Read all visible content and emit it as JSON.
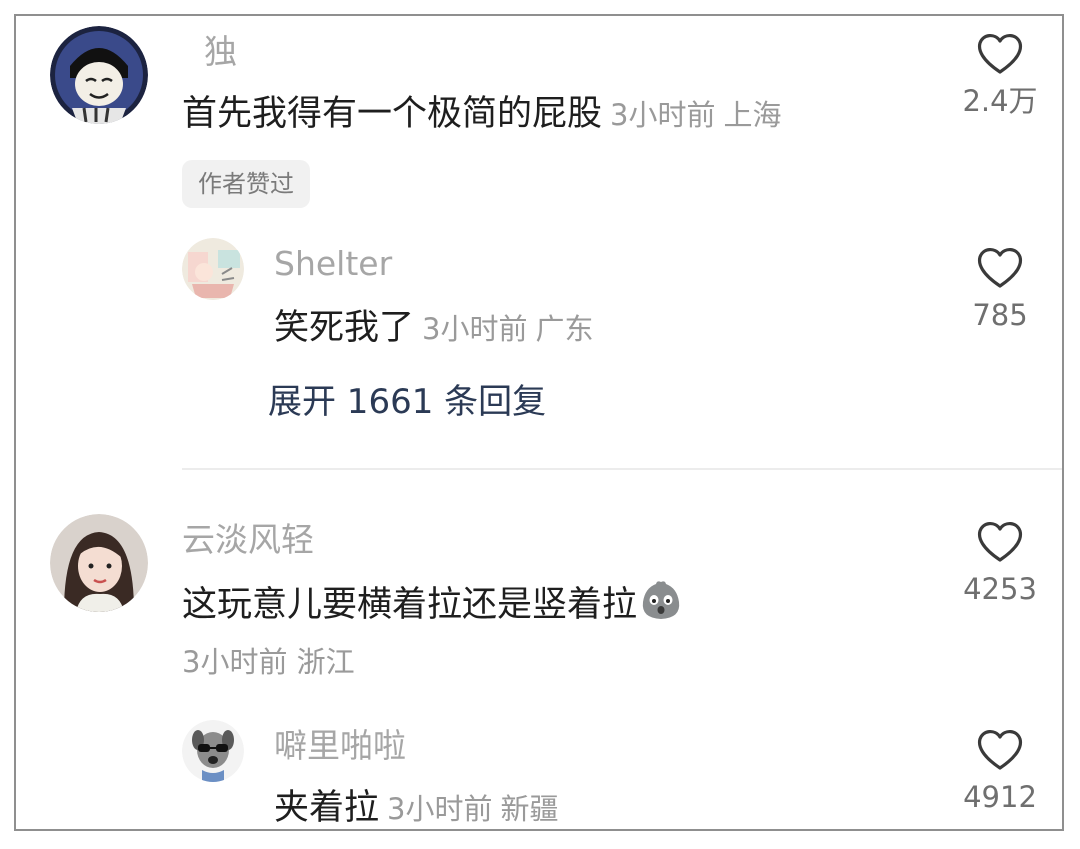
{
  "comments": [
    {
      "username": "独",
      "text": "首先我得有一个极简的屁股",
      "time": "3小时前",
      "location": "上海",
      "likes": "2.4万",
      "badge": "作者赞过",
      "replies": [
        {
          "username": "Shelter",
          "text": "笑死我了",
          "time": "3小时前",
          "location": "广东",
          "likes": "785"
        }
      ],
      "expand_label": "展开 1661 条回复"
    },
    {
      "username": "云淡风轻",
      "text": "这玩意儿要横着拉还是竖着拉",
      "time": "3小时前",
      "location": "浙江",
      "likes": "4253",
      "replies": [
        {
          "username": "噼里啪啦",
          "text": "夹着拉",
          "time": "3小时前",
          "location": "新疆",
          "likes": "4912"
        }
      ]
    }
  ],
  "icons": {
    "like": "heart-outline-icon",
    "emoji": "shocked-emoji-icon"
  },
  "colors": {
    "username": "#a6a6a6",
    "meta": "#9a9a9a",
    "expand_link": "#2b3a55",
    "badge_bg": "#f1f1f1"
  }
}
